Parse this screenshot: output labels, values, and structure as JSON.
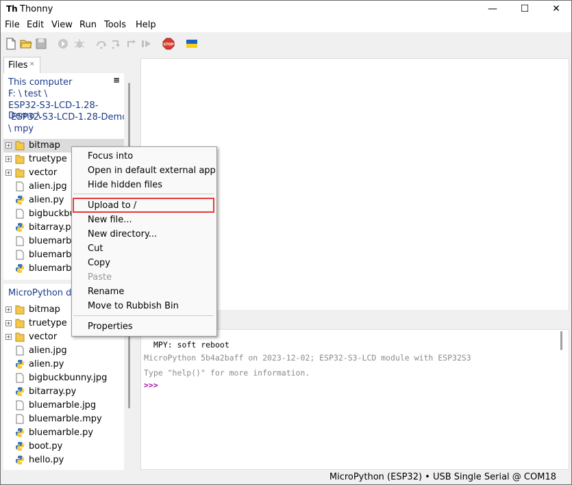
{
  "window": {
    "title": "Thonny",
    "app_icon": "Th",
    "controls": {
      "minimize": "—",
      "maximize": "☐",
      "close": "✕"
    }
  },
  "menubar": [
    "File",
    "Edit",
    "View",
    "Run",
    "Tools",
    "Help"
  ],
  "toolbar": {
    "icons": [
      "new-file-icon",
      "open-folder-icon",
      "save-icon",
      "run-icon",
      "debug-icon",
      "step-over-icon",
      "step-into-icon",
      "step-out-icon",
      "resume-icon",
      "stop-icon",
      "ukraine-flag-icon"
    ],
    "stop_label": "STOP"
  },
  "files_tab": {
    "label": "Files",
    "close": "×"
  },
  "local": {
    "header_line1": "This computer",
    "path_lines": [
      "F: \\ test \\",
      "ESP32-S3-LCD-1.28-Demo \\",
      " ESP32-S3-LCD-1.28-Demo",
      "\\ mpy"
    ],
    "menu_icon": "≡",
    "items": [
      {
        "name": "bitmap",
        "type": "folder"
      },
      {
        "name": "truetype",
        "type": "folder"
      },
      {
        "name": "vector",
        "type": "folder"
      },
      {
        "name": "alien.jpg",
        "type": "file"
      },
      {
        "name": "alien.py",
        "type": "python"
      },
      {
        "name": "bigbuckbu",
        "type": "file"
      },
      {
        "name": "bitarray.py",
        "type": "python"
      },
      {
        "name": "bluemarble",
        "type": "file"
      },
      {
        "name": "bluemarble",
        "type": "file"
      },
      {
        "name": "bluemarble",
        "type": "python"
      }
    ]
  },
  "device": {
    "header": "MicroPython de",
    "items": [
      {
        "name": "bitmap",
        "type": "folder"
      },
      {
        "name": "truetype",
        "type": "folder"
      },
      {
        "name": "vector",
        "type": "folder"
      },
      {
        "name": "alien.jpg",
        "type": "file"
      },
      {
        "name": "alien.py",
        "type": "python"
      },
      {
        "name": "bigbuckbunny.jpg",
        "type": "file"
      },
      {
        "name": "bitarray.py",
        "type": "python"
      },
      {
        "name": "bluemarble.jpg",
        "type": "file"
      },
      {
        "name": "bluemarble.mpy",
        "type": "file"
      },
      {
        "name": "bluemarble.py",
        "type": "python"
      },
      {
        "name": "boot.py",
        "type": "python"
      },
      {
        "name": "hello.py",
        "type": "python"
      }
    ]
  },
  "context_menu": {
    "items": [
      {
        "label": "Focus into"
      },
      {
        "label": "Open in default external app"
      },
      {
        "label": "Hide hidden files"
      },
      {
        "label": "Upload to /",
        "highlighted": true
      },
      {
        "label": "New file..."
      },
      {
        "label": "New directory..."
      },
      {
        "label": "Cut"
      },
      {
        "label": "Copy"
      },
      {
        "label": "Paste",
        "disabled": true
      },
      {
        "label": "Rename"
      },
      {
        "label": "Move to Rubbish Bin"
      },
      {
        "label": "Properties"
      }
    ],
    "highlight_color": "#e53935"
  },
  "shell": {
    "line1": "MPY: soft reboot",
    "line2": "MicroPython 5b4a2baff on 2023-12-02; ESP32-S3-LCD module with ESP32S3",
    "line3": "Type \"help()\" for more information.",
    "prompt": ">>>",
    "prompt_color": "#a010a0",
    "info_color": "#8a8a8a"
  },
  "statusbar": {
    "text": "MicroPython (ESP32)  •  USB Single Serial @ COM18"
  }
}
